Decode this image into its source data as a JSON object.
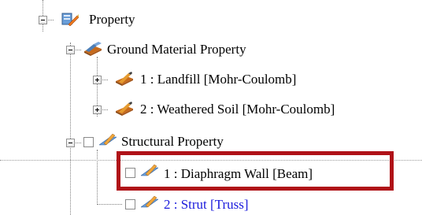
{
  "tree": {
    "root": {
      "label": "Property",
      "icon": "property-icon",
      "expanded": true
    },
    "ground_material": {
      "label": "Ground Material Property",
      "icon": "material-icon",
      "expanded": true,
      "items": [
        {
          "label": "1 : Landfill [Mohr-Coulomb]",
          "icon": "material-icon",
          "expanded": false
        },
        {
          "label": "2 : Weathered Soil [Mohr-Coulomb]",
          "icon": "material-icon",
          "expanded": false
        }
      ]
    },
    "structural": {
      "label": "Structural Property",
      "icon": "structural-icon",
      "expanded": true,
      "items": [
        {
          "label": "1 : Diaphragm Wall [Beam]",
          "icon": "structural-icon",
          "highlighted": true
        },
        {
          "label": "2 : Strut [Truss]",
          "icon": "structural-icon",
          "highlighted": false
        }
      ]
    }
  },
  "colors": {
    "highlight_border": "#b01218",
    "link_text": "#1a1adc"
  }
}
